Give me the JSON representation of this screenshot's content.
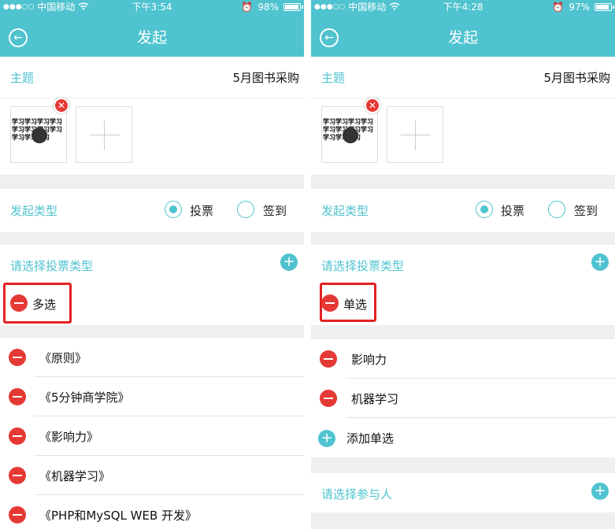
{
  "left": {
    "status": {
      "carrier": "中国移动",
      "time": "下午3:54",
      "battery": "98%"
    },
    "nav": {
      "title": "发起"
    },
    "subject": {
      "label": "主题",
      "value": "5月图书采购"
    },
    "thumb_text": "学习学习学习学习学习学习学习学习学习学习学习",
    "type": {
      "label": "发起类型",
      "options": [
        "投票",
        "签到"
      ],
      "selected": "投票"
    },
    "vote": {
      "label": "请选择投票类型",
      "mode": "多选"
    },
    "items": [
      "《原则》",
      "《5分钟商学院》",
      "《影响力》",
      "《机器学习》",
      "《PHP和MySQL WEB 开发》"
    ]
  },
  "right": {
    "status": {
      "carrier": "中国移动",
      "time": "下午4:28",
      "battery": "97%"
    },
    "nav": {
      "title": "发起"
    },
    "subject": {
      "label": "主题",
      "value": "5月图书采购"
    },
    "thumb_text": "学习学习学习学习学习学习学习学习学习学习学习",
    "type": {
      "label": "发起类型",
      "options": [
        "投票",
        "签到"
      ],
      "selected": "投票"
    },
    "vote": {
      "label": "请选择投票类型",
      "mode": "单选"
    },
    "items": [
      "影响力",
      "机器学习"
    ],
    "add_option_label": "添加单选",
    "participants_label": "请选择参与人"
  },
  "colors": {
    "accent": "#4fc3cf",
    "danger": "#e53935",
    "highlight": "#e32222"
  }
}
